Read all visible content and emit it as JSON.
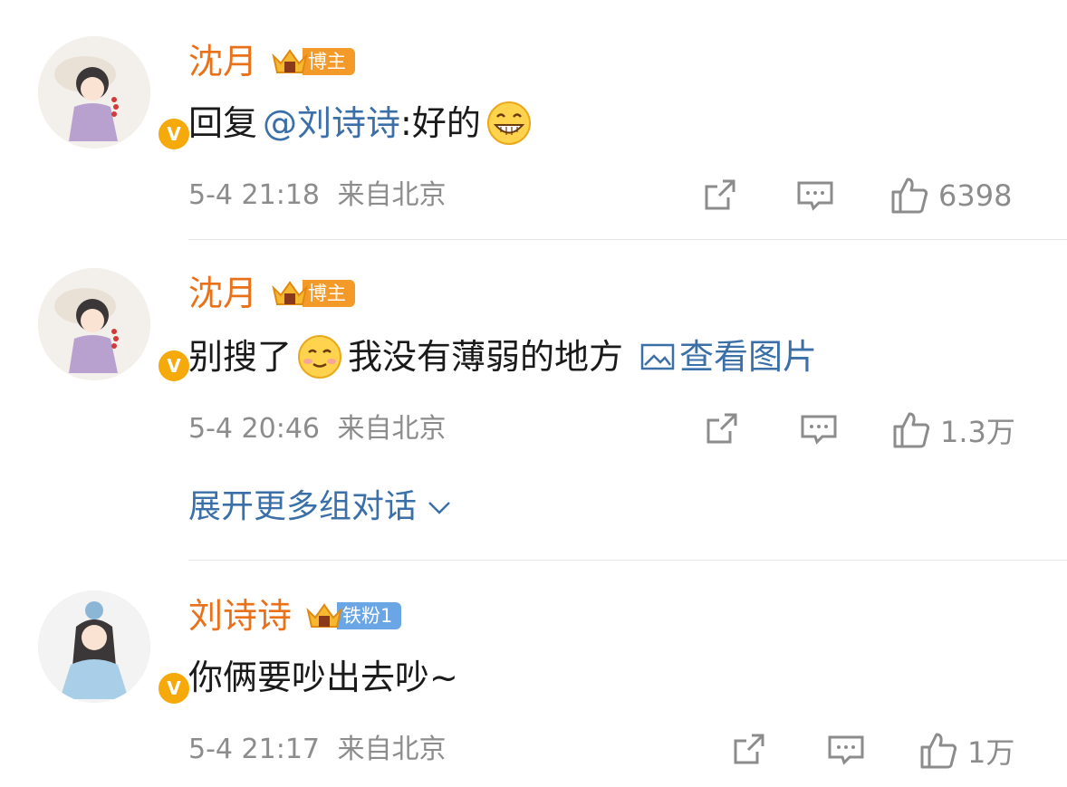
{
  "colors": {
    "username": "#e87119",
    "link": "#3a6fa8",
    "meta": "#8c8c8c",
    "tag_orange": "#f39a28",
    "tag_blue": "#6aa5e6",
    "verified": "#f5a90a"
  },
  "comments": [
    {
      "username": "沈月",
      "tag": "博主",
      "text_prefix": "回复",
      "mention": "@刘诗诗",
      "text": ":好的",
      "emoji": "grin-emoji",
      "time": "5-4 21:18",
      "location": "来自北京",
      "likes": "6398"
    },
    {
      "username": "沈月",
      "tag": "博主",
      "text_a": "别搜了",
      "emoji": "smile-emoji",
      "text_b": "我没有薄弱的地方",
      "image_link": "查看图片",
      "time": "5-4 20:46",
      "location": "来自北京",
      "likes": "1.3万"
    },
    {
      "username": "刘诗诗",
      "tag": "铁粉1",
      "text": "你俩要吵出去吵~",
      "time": "5-4 21:17",
      "location": "来自北京",
      "likes": "1万"
    }
  ],
  "expand_label": "展开更多组对话",
  "icons": [
    "share-icon",
    "comment-icon",
    "like-icon",
    "chevron-down-icon",
    "image-icon",
    "crown-icon",
    "verified-icon"
  ]
}
